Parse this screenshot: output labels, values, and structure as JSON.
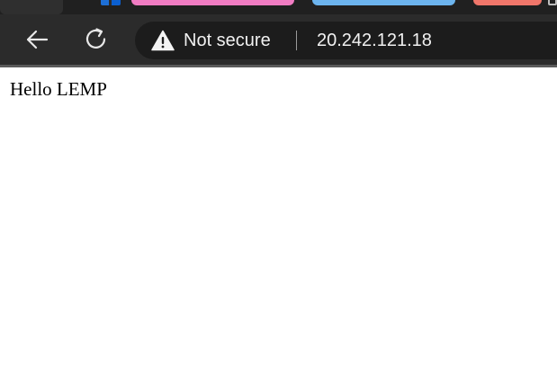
{
  "tabs": {
    "group_colors": [
      "#f07cc2",
      "#6cb4ee",
      "#f0766a"
    ]
  },
  "toolbar": {
    "back_icon": "arrow-left-icon",
    "reload_icon": "reload-icon"
  },
  "address_bar": {
    "security_icon": "warning-triangle-icon",
    "security_label": "Not secure",
    "url": "20.242.121.18"
  },
  "page": {
    "body_text": "Hello LEMP"
  },
  "colors": {
    "toolbar_bg": "#2b2b2b",
    "address_bar_bg": "#1c1c1c",
    "text_light": "#f1f1f1",
    "page_bg": "#ffffff"
  }
}
